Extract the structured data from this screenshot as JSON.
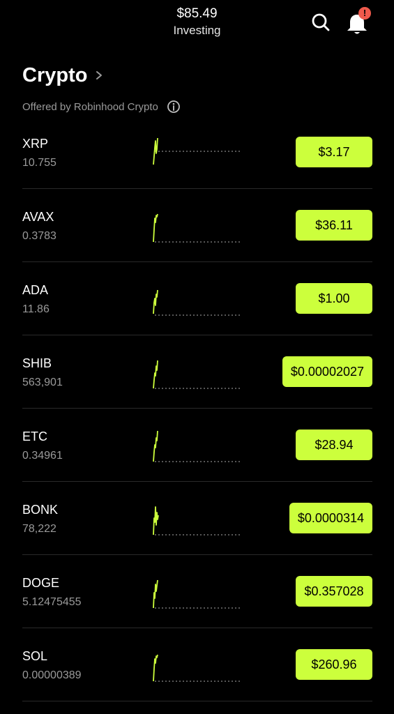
{
  "header": {
    "portfolio_value": "$85.49",
    "portfolio_label": "Investing",
    "notification_badge": "!"
  },
  "section": {
    "title": "Crypto",
    "subtitle": "Offered by Robinhood Crypto"
  },
  "colors": {
    "accent": "#ccff3c",
    "background": "#000000",
    "badge": "#ef5a4c",
    "muted_text": "#9a9a9a"
  },
  "icons": {
    "search": "search-icon",
    "bell": "bell-icon",
    "chevron": "chevron-right-icon",
    "info": "info-icon"
  },
  "holdings": [
    {
      "symbol": "XRP",
      "quantity": "10.755",
      "price": "$3.17"
    },
    {
      "symbol": "AVAX",
      "quantity": "0.3783",
      "price": "$36.11"
    },
    {
      "symbol": "ADA",
      "quantity": "11.86",
      "price": "$1.00"
    },
    {
      "symbol": "SHIB",
      "quantity": "563,901",
      "price": "$0.00002027"
    },
    {
      "symbol": "ETC",
      "quantity": "0.34961",
      "price": "$28.94"
    },
    {
      "symbol": "BONK",
      "quantity": "78,222",
      "price": "$0.0000314"
    },
    {
      "symbol": "DOGE",
      "quantity": "5.12475455",
      "price": "$0.357028"
    },
    {
      "symbol": "SOL",
      "quantity": "0.00000389",
      "price": "$260.96"
    }
  ]
}
